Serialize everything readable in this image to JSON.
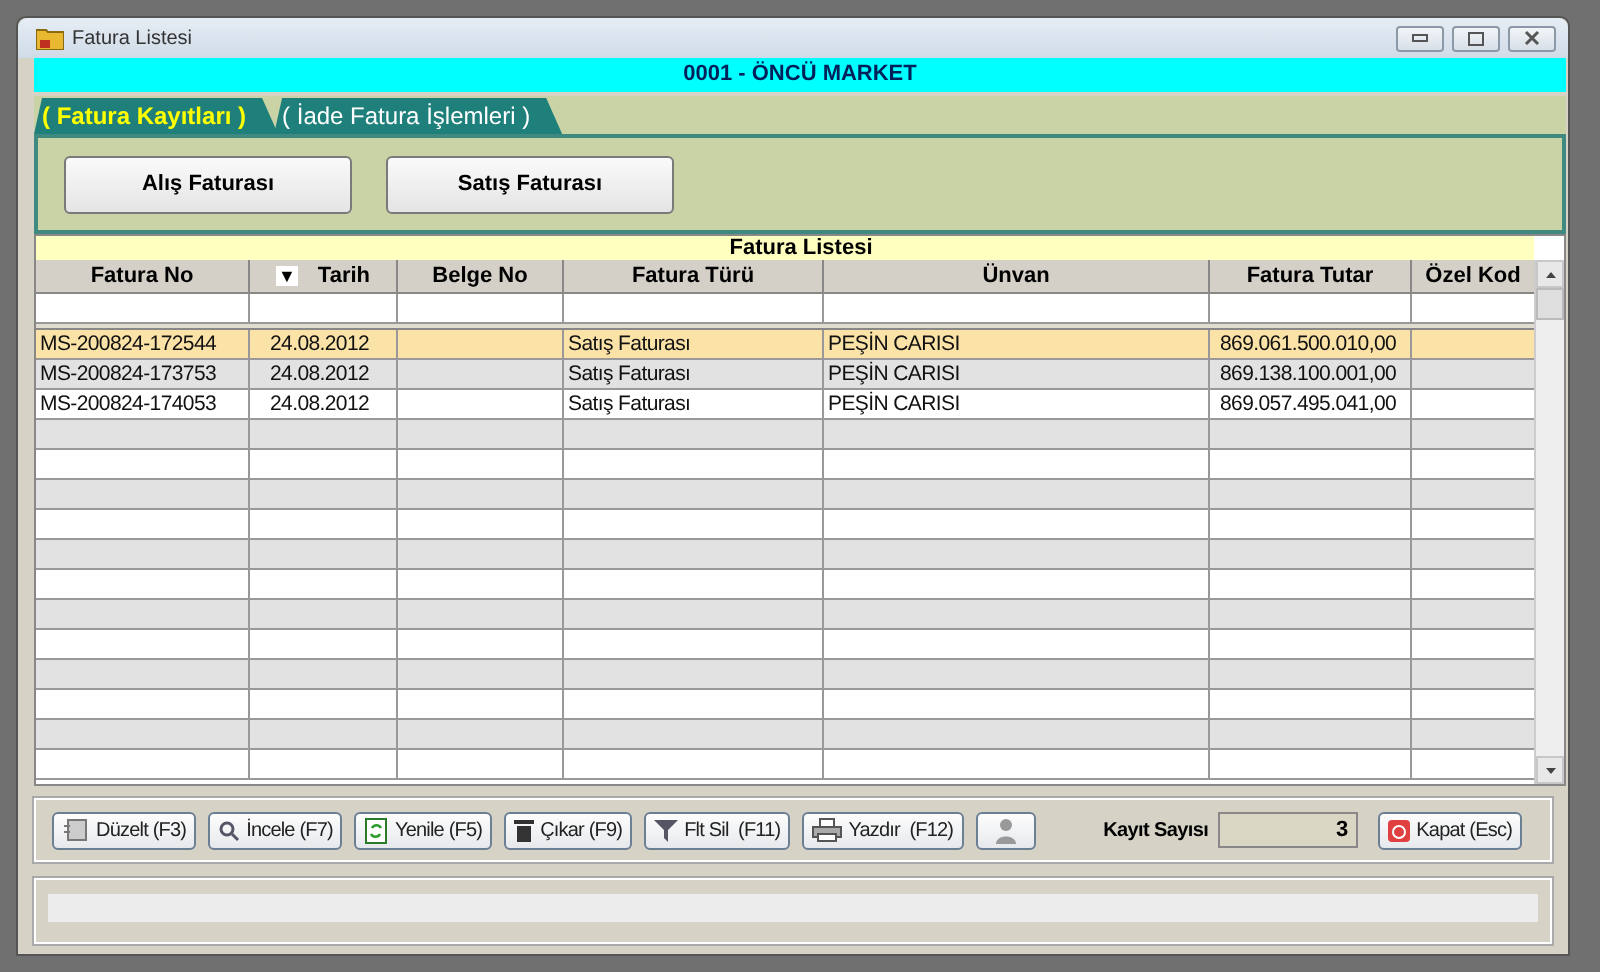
{
  "window": {
    "title": "Fatura Listesi"
  },
  "banner": "0001 - ÖNCÜ MARKET",
  "tabs": [
    {
      "label": "( Fatura Kayıtları )",
      "selected": true
    },
    {
      "label": "( İade Fatura İşlemleri )",
      "selected": false
    }
  ],
  "invoice_buttons": [
    "Alış Faturası",
    "Satış Faturası"
  ],
  "table": {
    "title": "Fatura Listesi",
    "columns": [
      {
        "label": "Fatura No"
      },
      {
        "label": "Tarih",
        "sort_marker": "▼"
      },
      {
        "label": "Belge No"
      },
      {
        "label": "Fatura Türü"
      },
      {
        "label": "Ünvan"
      },
      {
        "label": "Fatura Tutar"
      },
      {
        "label": "Özel Kod"
      }
    ],
    "rows": [
      {
        "cells": [
          "MS-200824-172544",
          "24.08.2012",
          "",
          "Satış Faturası",
          "PEŞİN CARISI",
          "869.061.500.010,00",
          ""
        ],
        "selected": true
      },
      {
        "cells": [
          "MS-200824-173753",
          "24.08.2012",
          "",
          "Satış Faturası",
          "PEŞİN CARISI",
          "869.138.100.001,00",
          ""
        ],
        "selected": false
      },
      {
        "cells": [
          "MS-200824-174053",
          "24.08.2012",
          "",
          "Satış Faturası",
          "PEŞİN CARISI",
          "869.057.495.041,00",
          ""
        ],
        "selected": false
      }
    ]
  },
  "toolbar": [
    {
      "kind": "edit",
      "label": "Düzelt (F3)"
    },
    {
      "kind": "search",
      "label": "İncele (F7)"
    },
    {
      "kind": "refresh",
      "label": "Yenile (F5)"
    },
    {
      "kind": "delete",
      "label": "Çıkar (F9)"
    },
    {
      "kind": "filter",
      "label": "Flt Sil  (F11)"
    },
    {
      "kind": "print",
      "label": "Yazdır  (F12)"
    },
    {
      "kind": "user"
    }
  ],
  "record_count": {
    "label": "Kayıt Sayısı",
    "value": "3"
  },
  "close_button": {
    "label": "Kapat (Esc)"
  }
}
